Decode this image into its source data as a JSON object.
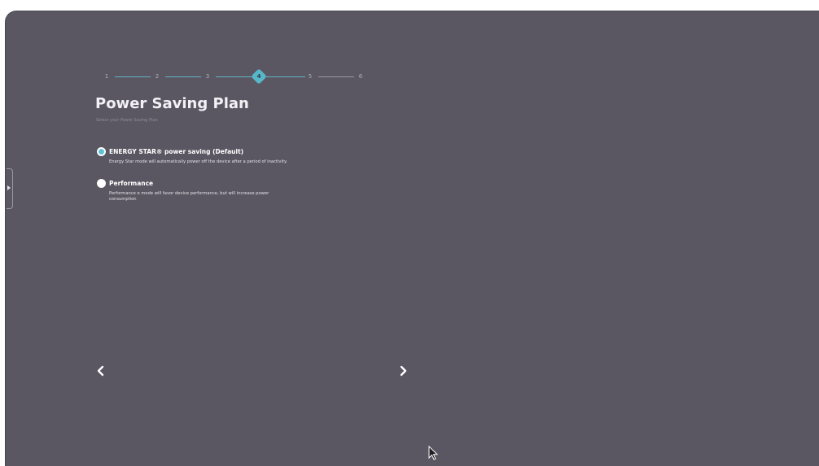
{
  "stepper": {
    "steps": [
      "1",
      "2",
      "3",
      "4",
      "5",
      "6"
    ],
    "current": "4"
  },
  "page": {
    "title": "Power Saving Plan",
    "subtitle": "Select your Power Saving Plan"
  },
  "options": [
    {
      "label": "ENERGY STAR® power saving (Default)",
      "description": "Energy Star mode will automatically power off the device after a period of inactivity.",
      "selected": true
    },
    {
      "label": "Performance",
      "description": "Performance e mode will favor device performance, but will increase power consumption",
      "selected": false
    }
  ],
  "navigation": {
    "back_icon": "chevron-left-icon",
    "next_icon": "chevron-right-icon"
  },
  "colors": {
    "background": "#5a5762",
    "accent": "#57b7c8",
    "text": "#ffffff"
  }
}
